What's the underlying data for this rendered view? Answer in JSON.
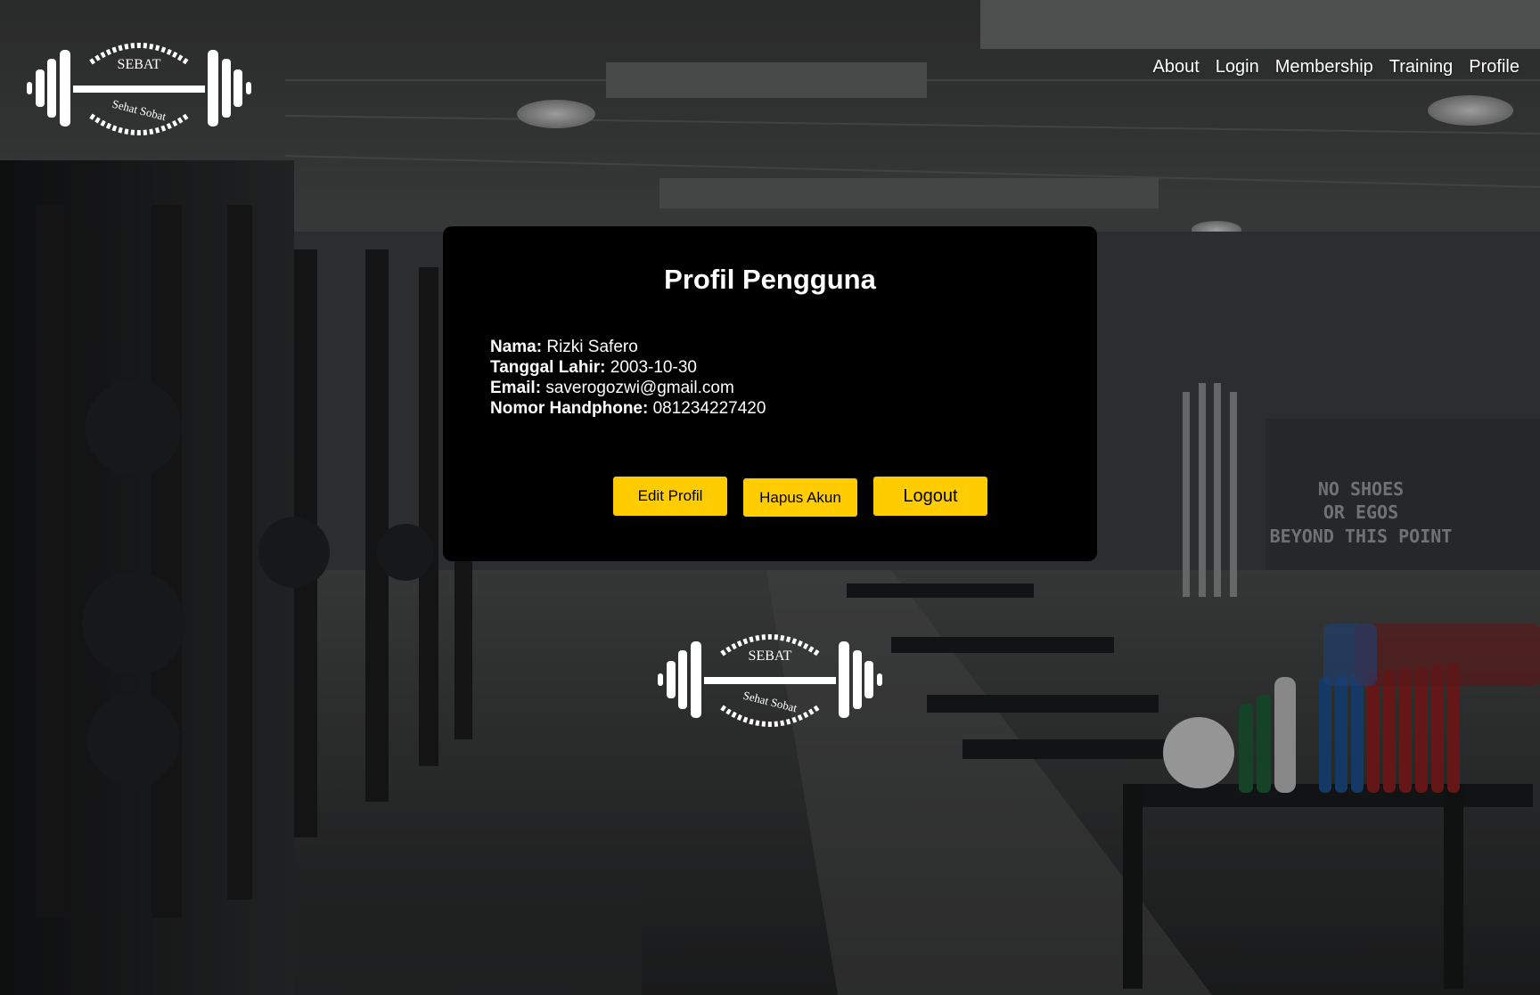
{
  "logo": {
    "brand_top": "SEBAT",
    "brand_bottom": "Sehat Sobat"
  },
  "nav": {
    "items": [
      "About",
      "Login",
      "Membership",
      "Training",
      "Profile"
    ]
  },
  "profile": {
    "title": "Profil Pengguna",
    "fields": [
      {
        "label": "Nama:",
        "value": "Rizki Safero"
      },
      {
        "label": "Tanggal Lahir:",
        "value": "2003-10-30"
      },
      {
        "label": "Email:",
        "value": "saverogozwi@gmail.com"
      },
      {
        "label": "Nomor Handphone:",
        "value": "081234227420"
      }
    ],
    "buttons": {
      "edit": "Edit Profil",
      "delete": "Hapus Akun",
      "logout": "Logout"
    }
  },
  "background": {
    "wall_sign": [
      "NO SHOES",
      "OR EGOS",
      "BEYOND THIS POINT"
    ]
  },
  "colors": {
    "accent": "#ffcc00",
    "card": "#000000",
    "text": "#ffffff"
  }
}
